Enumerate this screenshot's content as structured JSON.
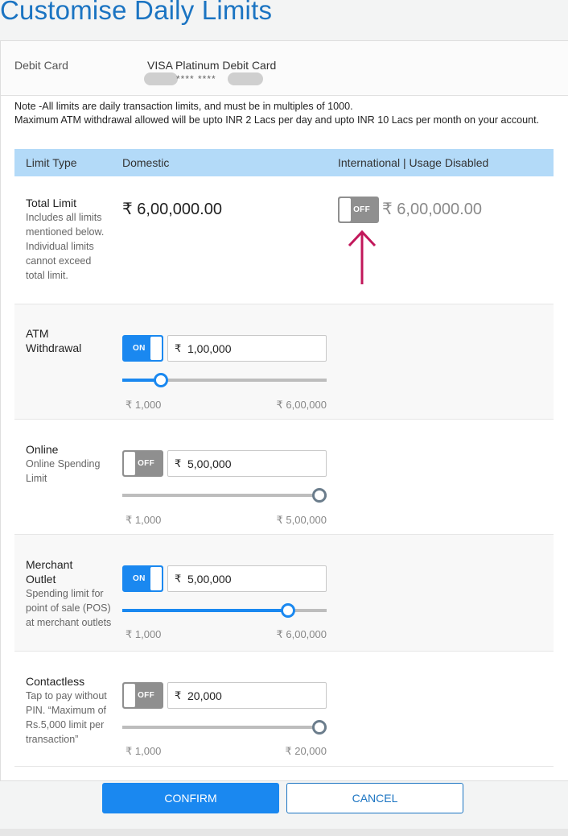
{
  "page": {
    "title": "Customise Daily Limits"
  },
  "card": {
    "label": "Debit Card",
    "name": "VISA Platinum Debit Card",
    "masked_number": "**** ****"
  },
  "note": {
    "line1": "Note -All limits are daily transaction limits, and must be in multiples of 1000.",
    "line2": "Maximum ATM withdrawal allowed will be upto INR 2 Lacs per day and upto INR 10 Lacs per month on your account."
  },
  "table": {
    "headers": {
      "limit_type": "Limit Type",
      "domestic": "Domestic",
      "international": "International | Usage Disabled"
    },
    "total": {
      "name": "Total Limit",
      "desc": "Includes all limits mentioned below. Individual limits cannot exceed total limit.",
      "domestic_amount": "₹ 6,00,000.00",
      "intl_toggle": "OFF",
      "intl_amount": "₹ 6,00,000.00"
    },
    "rows": [
      {
        "name": "ATM Withdrawal",
        "desc": "",
        "toggle": "ON",
        "currency": "₹",
        "value": "1,00,000",
        "min": "₹ 1,000",
        "max": "₹ 6,00,000",
        "fraction": 0.165
      },
      {
        "name": "Online",
        "desc": "Online Spending Limit",
        "toggle": "OFF",
        "currency": "₹",
        "value": "5,00,000",
        "min": "₹ 1,000",
        "max": "₹ 5,00,000",
        "fraction": 1.0
      },
      {
        "name": "Merchant Outlet",
        "desc": "Spending limit for point of sale (POS) at merchant outlets",
        "toggle": "ON",
        "currency": "₹",
        "value": "5,00,000",
        "min": "₹ 1,000",
        "max": "₹ 6,00,000",
        "fraction": 0.833
      },
      {
        "name": "Contactless",
        "desc": "Tap to pay without PIN. “Maximum of Rs.5,000 limit per transaction”",
        "toggle": "OFF",
        "currency": "₹",
        "value": "20,000",
        "min": "₹ 1,000",
        "max": "₹ 20,000",
        "fraction": 1.0
      }
    ]
  },
  "buttons": {
    "confirm": "CONFIRM",
    "cancel": "CANCEL"
  },
  "colors": {
    "accent": "#1a88f0",
    "title": "#1b74c2",
    "header_bg": "#b3daf8",
    "toggle_off": "#8f8f8f",
    "arrow": "#c2185b"
  }
}
